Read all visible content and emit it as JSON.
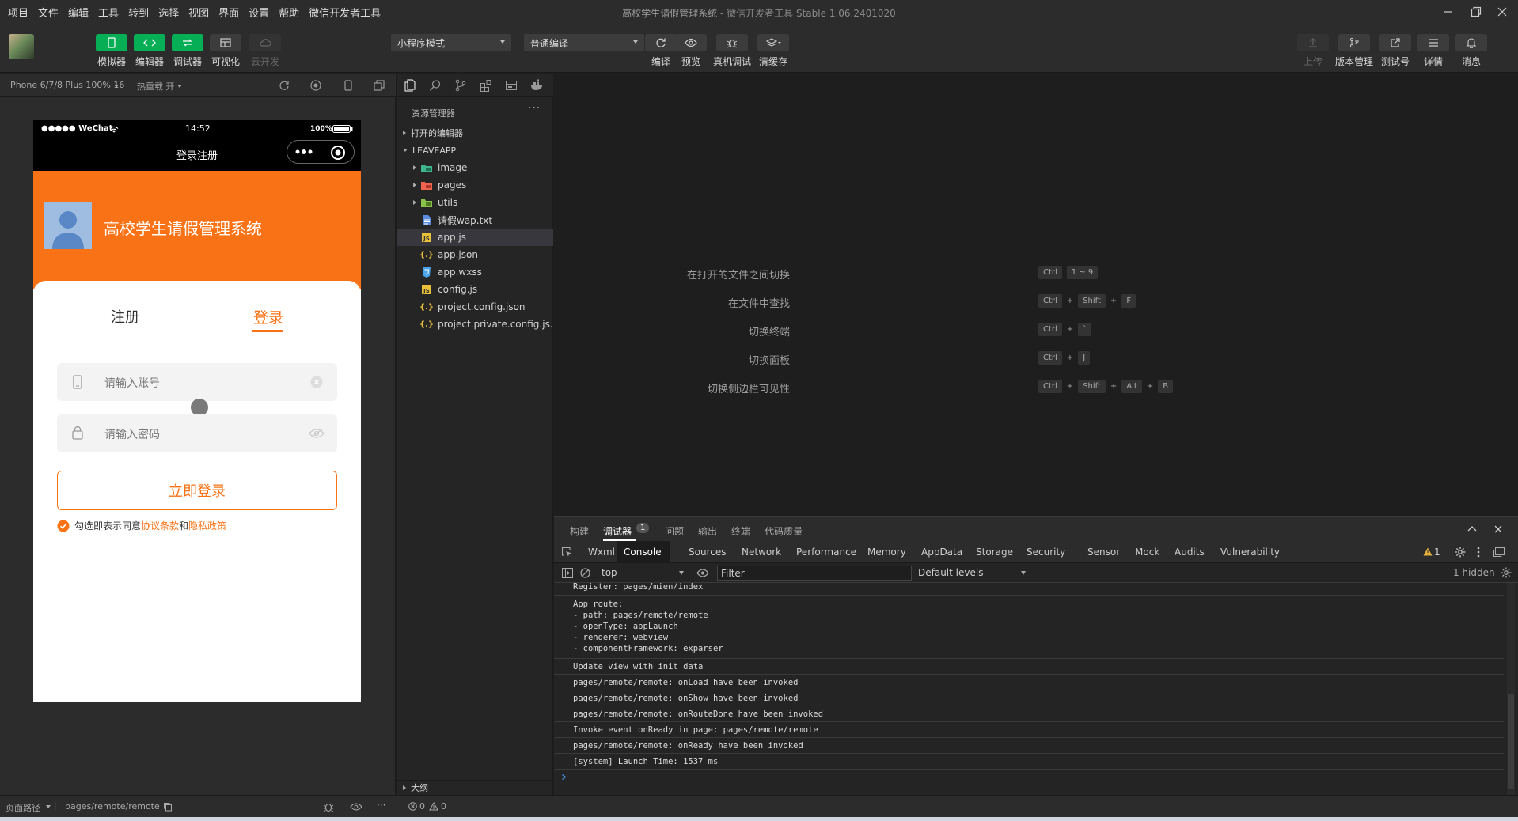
{
  "menubar": {
    "items": [
      "项目",
      "文件",
      "编辑",
      "工具",
      "转到",
      "选择",
      "视图",
      "界面",
      "设置",
      "帮助",
      "微信开发者工具"
    ],
    "title": "高校学生请假管理系统",
    "subtitle": "- 微信开发者工具 Stable 1.06.2401020"
  },
  "toolbar": {
    "simulator": "模拟器",
    "editor": "编辑器",
    "debugger": "调试器",
    "visual": "可视化",
    "cloud": "云开发",
    "mode_select": "小程序模式",
    "compile_select": "普通编译",
    "compile": "编译",
    "preview": "预览",
    "remote_debug": "真机调试",
    "clear_cache": "清缓存",
    "upload": "上传",
    "version": "版本管理",
    "test": "测试号",
    "details": "详情",
    "messages": "消息"
  },
  "simulator": {
    "device": "iPhone 6/7/8 Plus 100% 16",
    "hotreload": "热重载 开",
    "status_left": "●●●●● WeChat",
    "time": "14:52",
    "battery": "100%",
    "nav_title": "登录注册",
    "app_title": "高校学生请假管理系统",
    "tab_register": "注册",
    "tab_login": "登录",
    "account_placeholder": "请输入账号",
    "password_placeholder": "请输入密码",
    "login_button": "立即登录",
    "agree_prefix": "勾选即表示同意",
    "agree_terms": "协议条款",
    "agree_and": "和",
    "agree_privacy": "隐私政策"
  },
  "explorer": {
    "header": "资源管理器",
    "open_editors": "打开的编辑器",
    "project": "LEAVEAPP",
    "outline": "大纲",
    "files": [
      {
        "name": "image",
        "type": "folder",
        "color": "#3fb68e"
      },
      {
        "name": "pages",
        "type": "folder",
        "color": "#f0644f"
      },
      {
        "name": "utils",
        "type": "folder",
        "color": "#8ac24a"
      },
      {
        "name": "请假wap.txt",
        "type": "txt",
        "color": "#5a8de0"
      },
      {
        "name": "app.js",
        "type": "js",
        "color": "#e8c03a"
      },
      {
        "name": "app.json",
        "type": "json",
        "color": "#e8c03a"
      },
      {
        "name": "app.wxss",
        "type": "wxss",
        "color": "#4aa3e8"
      },
      {
        "name": "config.js",
        "type": "js",
        "color": "#e8c03a"
      },
      {
        "name": "project.config.json",
        "type": "json",
        "color": "#e8c03a"
      },
      {
        "name": "project.private.config.js...",
        "type": "json",
        "color": "#e8c03a"
      }
    ]
  },
  "editor": {
    "hints": [
      {
        "label": "在打开的文件之间切换",
        "keys": [
          "Ctrl",
          "1 ~ 9"
        ]
      },
      {
        "label": "在文件中查找",
        "keys": [
          "Ctrl",
          "+",
          "Shift",
          "+",
          "F"
        ]
      },
      {
        "label": "切换终端",
        "keys": [
          "Ctrl",
          "+",
          "`"
        ]
      },
      {
        "label": "切换面板",
        "keys": [
          "Ctrl",
          "+",
          "J"
        ]
      },
      {
        "label": "切换侧边栏可见性",
        "keys": [
          "Ctrl",
          "+",
          "Shift",
          "+",
          "Alt",
          "+",
          "B"
        ]
      }
    ]
  },
  "debug": {
    "top_tabs": [
      "构建",
      "调试器",
      "问题",
      "输出",
      "终端",
      "代码质量"
    ],
    "debugger_badge": "1",
    "devtools_tabs": [
      "Wxml",
      "Console",
      "Sources",
      "Network",
      "Performance",
      "Memory",
      "AppData",
      "Storage",
      "Security",
      "Sensor",
      "Mock",
      "Audits",
      "Vulnerability"
    ],
    "warning_count": "1",
    "context": "top",
    "filter_placeholder": "Filter",
    "levels": "Default levels",
    "hidden": "1 hidden",
    "console_lines": [
      "Register: pages/mien/index",
      "App route:\n- path: pages/remote/remote\n- openType: appLaunch\n- renderer: webview\n- componentFramework: exparser",
      "Update view with init data",
      "pages/remote/remote: onLoad have been invoked",
      "pages/remote/remote: onShow have been invoked",
      "pages/remote/remote: onRouteDone have been invoked",
      "Invoke event onReady in page: pages/remote/remote",
      "pages/remote/remote: onReady have been invoked",
      "[system] Launch Time: 1537 ms"
    ]
  },
  "statusbar": {
    "page_path_label": "页面路径",
    "page_path": "pages/remote/remote",
    "errors": "0",
    "warnings": "0"
  },
  "colors": {
    "accent": "#f97316",
    "wechat_green": "#06ae56"
  }
}
